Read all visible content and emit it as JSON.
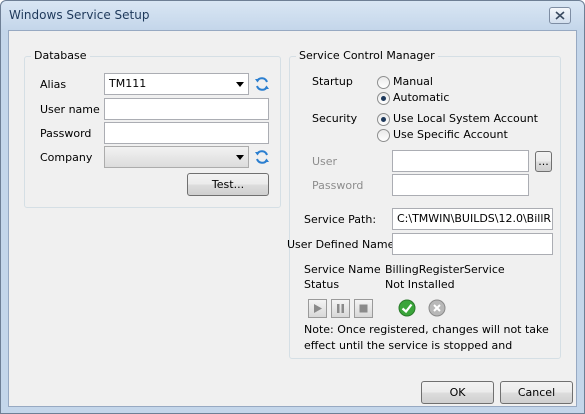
{
  "window": {
    "title": "Windows Service Setup"
  },
  "database": {
    "group_title": "Database",
    "alias_label": "Alias",
    "alias_value": "TM111",
    "username_label": "User name",
    "username_value": "",
    "password_label": "Password",
    "password_value": "",
    "company_label": "Company",
    "company_value": "",
    "test_button": "Test..."
  },
  "scm": {
    "group_title": "Service Control Manager",
    "startup_label": "Startup",
    "startup_options": [
      "Manual",
      "Automatic"
    ],
    "startup_selected": "Automatic",
    "security_label": "Security",
    "security_options": [
      "Use Local System Account",
      "Use Specific Account"
    ],
    "security_selected": "Use Local System Account",
    "user_label": "User",
    "user_value": "",
    "browse_button": "...",
    "password_label": "Password",
    "password_value": "",
    "service_path_label": "Service Path:",
    "service_path_value": "C:\\TMWIN\\BUILDS\\12.0\\BillR",
    "user_defined_name_label": "User Defined Name",
    "user_defined_name_value": "",
    "service_name_label": "Service Name",
    "service_name_value": "BillingRegisterService",
    "status_label": "Status",
    "status_value": "Not Installed",
    "note_text": "Note:  Once registered, changes will not take effect until the service is stopped and"
  },
  "footer": {
    "ok_button": "OK",
    "cancel_button": "Cancel"
  },
  "colors": {
    "accent": "#1e395b",
    "install_green": "#3aa53a",
    "uninstall_gray": "#9a9a9a"
  }
}
